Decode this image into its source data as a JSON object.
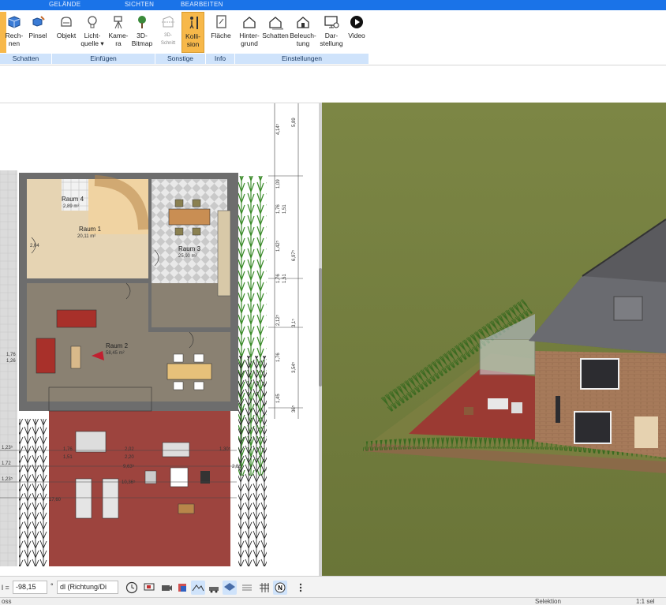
{
  "tabs": [
    "GELÄNDE",
    "SICHTEN",
    "BEARBEITEN"
  ],
  "ribbon": {
    "buttons": [
      {
        "label": "Rech-\nnen"
      },
      {
        "label": "Pinsel"
      },
      {
        "label": "Objekt"
      },
      {
        "label": "Licht-\nquelle ▾"
      },
      {
        "label": "Kame-\nra"
      },
      {
        "label": "3D-\nBitmap"
      },
      {
        "label": "3D-\nSchnitt"
      },
      {
        "label": "Kolli-\nsion"
      },
      {
        "label": "Fläche"
      },
      {
        "label": "Hinter-\ngrund"
      },
      {
        "label": "Schatten"
      },
      {
        "label": "Beleuch-\ntung"
      },
      {
        "label": "Dar-\nstellung"
      },
      {
        "label": "Video"
      }
    ],
    "groups": [
      "Schatten",
      "Einfügen",
      "Sonstige",
      "Info",
      "Einstellungen"
    ]
  },
  "plan": {
    "rooms": [
      {
        "name": "Raum 4",
        "area": "2,89 m²"
      },
      {
        "name": "Raum 1",
        "area": "20,11 m²"
      },
      {
        "name": "Raum 3",
        "area": "25,90 m²"
      },
      {
        "name": "Raum 2",
        "area": "58,45 m²"
      }
    ],
    "dims_right": [
      "5,89",
      "4,14⁵",
      "1,09",
      "1,76",
      "1,51",
      "1,42⁵",
      "6,97⁵",
      "1,76",
      "1,51",
      "2,12⁵",
      "3,1⁵",
      "1,76",
      "3,54⁵",
      "1,45",
      "36⁵"
    ],
    "dims_left": [
      "1,23⁵",
      "1,72",
      "1,23⁵",
      "1,76",
      "2,04",
      "1,26"
    ],
    "dims_terrace": [
      "1,76",
      "1,51",
      "2,02",
      "2,20",
      "1,30⁵",
      "9,63⁵",
      "10,36⁵",
      "17,60",
      "2,86"
    ]
  },
  "bottombar": {
    "label": "l =",
    "value": "-98,15",
    "unit": "°",
    "select": "dl (Richtung/Di"
  },
  "status": {
    "left": "oss",
    "middle": "Selektion",
    "right": "1:1 sel"
  },
  "colors": {
    "ribbon_blue": "#1a73e8",
    "active": "#f7b84a",
    "grass": "#6f7a3d",
    "terrace": "#8a3a32"
  }
}
